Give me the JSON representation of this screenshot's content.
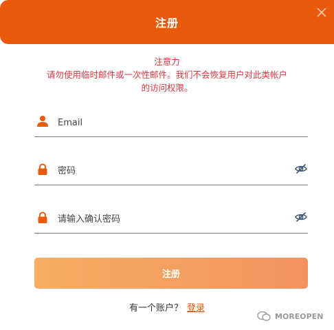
{
  "dialog": {
    "title": "注册",
    "close_icon": "close-icon"
  },
  "notice": {
    "line1": "注意力",
    "line2": "请勿使用临时邮件或一次性邮件。我们不会恢复用户对此类帐户",
    "line3": "的访问权限。"
  },
  "form": {
    "email_placeholder": "Email",
    "email_value": "",
    "email_icon": "user-icon",
    "password_placeholder": "密码",
    "password_value": "",
    "password_icon": "lock-icon",
    "confirm_placeholder": "请输入确认密码",
    "confirm_value": "",
    "confirm_icon": "lock-icon",
    "visibility_icon": "eye-slash-icon",
    "submit_label": "注册"
  },
  "footer": {
    "prompt": "有一个账户？",
    "login_link": "登录"
  },
  "watermark": {
    "text": "MOREOPEN"
  },
  "colors": {
    "brand": "#e85a0c",
    "warning_text": "#d9373f",
    "button_gradient_start": "#f7ae62",
    "button_gradient_end": "#f2935f"
  }
}
